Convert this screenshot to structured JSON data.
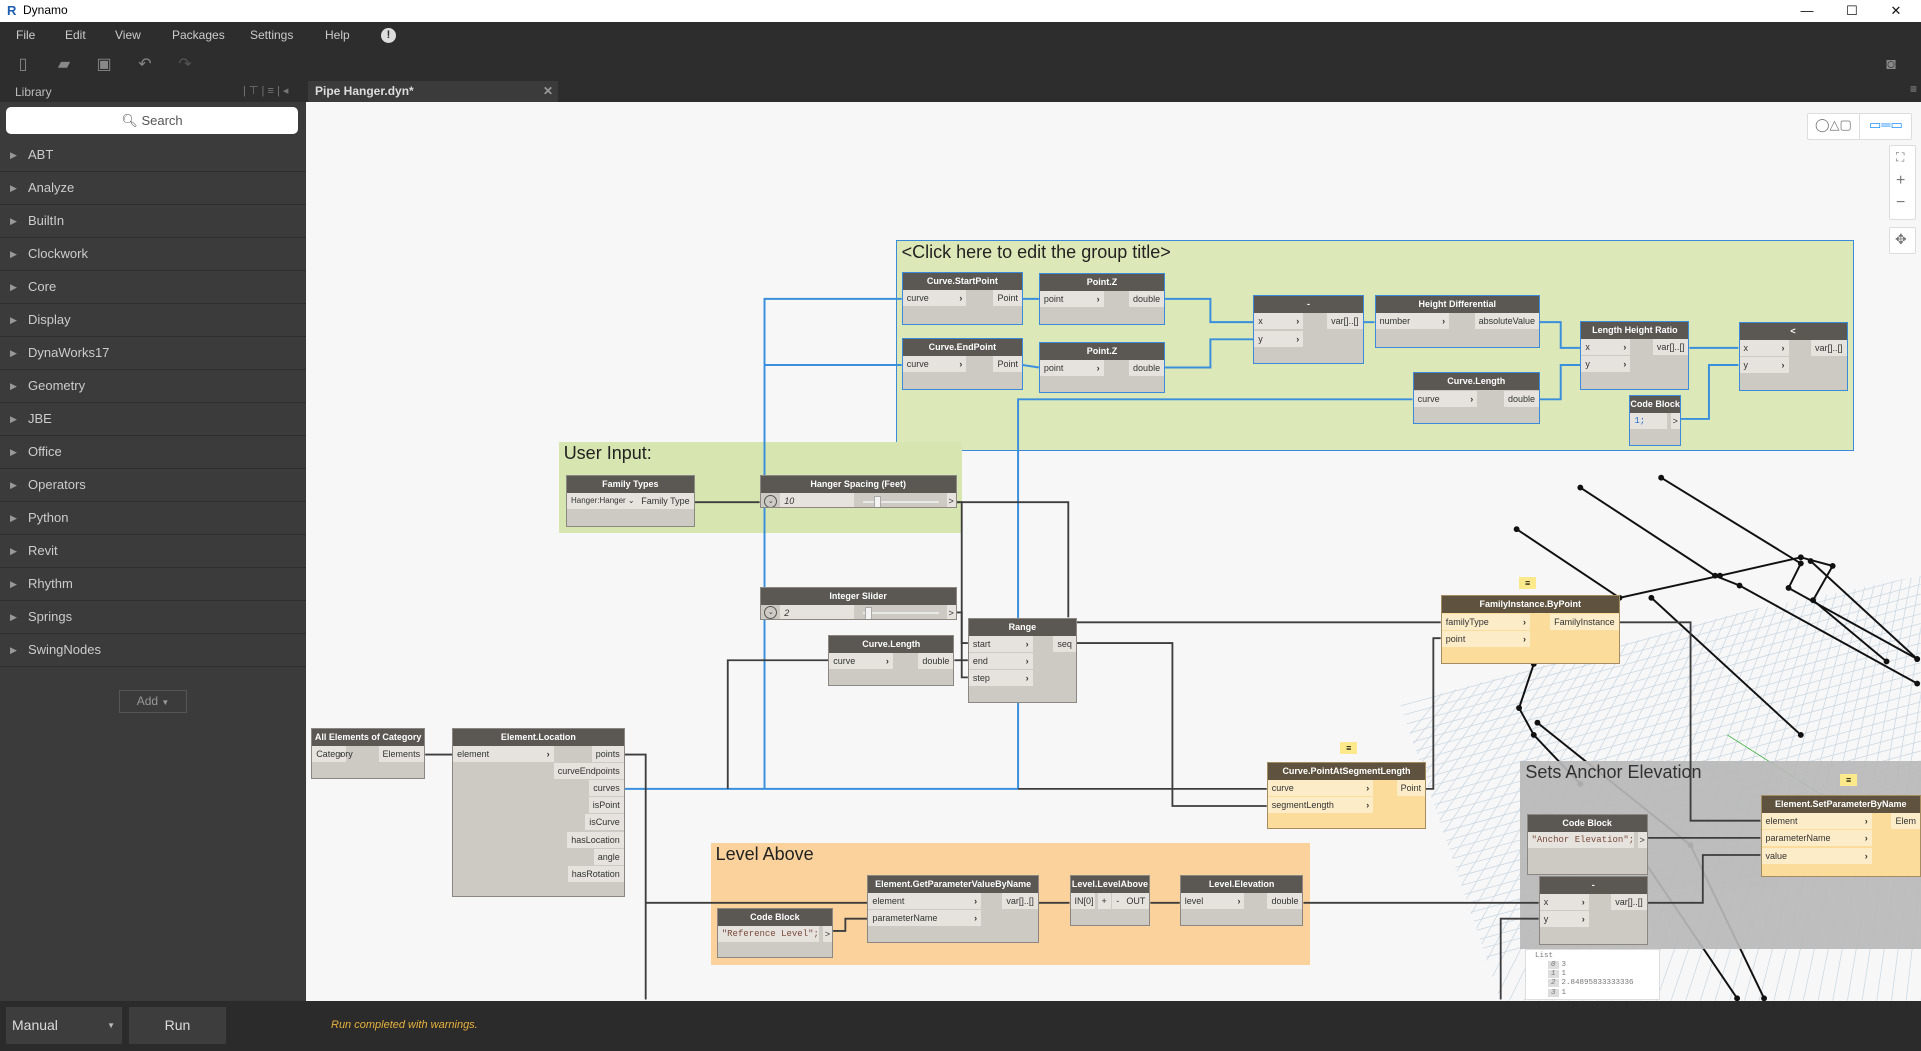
{
  "window": {
    "title": "Dynamo",
    "minimize": "—",
    "maximize": "☐",
    "close": "✕"
  },
  "menu": [
    "File",
    "Edit",
    "View",
    "Packages",
    "Settings",
    "Help"
  ],
  "library": {
    "header": "Library",
    "search_placeholder": "Search",
    "items": [
      "ABT",
      "Analyze",
      "BuiltIn",
      "Clockwork",
      "Core",
      "Display",
      "DynaWorks17",
      "Geometry",
      "JBE",
      "Office",
      "Operators",
      "Python",
      "Revit",
      "Rhythm",
      "Springs",
      "SwingNodes"
    ],
    "add_label": "Add"
  },
  "tab": {
    "label": "Pipe Hanger.dyn*"
  },
  "groups": [
    {
      "title": "<Click here to edit the group title>",
      "color": "#dce8b8"
    },
    {
      "title": "User Input:",
      "color": "#d7e6b0"
    },
    {
      "title": "Level Above",
      "color": "#fbd29c"
    },
    {
      "title": "Sets Anchor Elevation",
      "color": "#b9b9b9"
    }
  ],
  "nodes": [
    {
      "title": "Curve.StartPoint",
      "inputs": [
        "curve"
      ],
      "outputs": [
        "Point"
      ]
    },
    {
      "title": "Point.Z",
      "inputs": [
        "point"
      ],
      "outputs": [
        "double"
      ]
    },
    {
      "title": "Curve.EndPoint",
      "inputs": [
        "curve"
      ],
      "outputs": [
        "Point"
      ]
    },
    {
      "title": "Point.Z",
      "inputs": [
        "point"
      ],
      "outputs": [
        "double"
      ]
    },
    {
      "title": "-",
      "inputs": [
        "x",
        "y"
      ],
      "outputs": [
        "var[]..[]"
      ]
    },
    {
      "title": "Height Differential",
      "inputs": [
        "number"
      ],
      "outputs": [
        "absoluteValue"
      ]
    },
    {
      "title": "Length Height Ratio",
      "inputs": [
        "x",
        "y"
      ],
      "outputs": [
        "var[]..[]"
      ]
    },
    {
      "title": "<",
      "inputs": [
        "x",
        "y"
      ],
      "outputs": [
        "var[]..[]"
      ]
    },
    {
      "title": "Curve.Length",
      "inputs": [
        "curve"
      ],
      "outputs": [
        "double"
      ]
    },
    {
      "title": "Code Block",
      "code": "1;",
      "outputs": [
        ">"
      ]
    },
    {
      "title": "Family Types",
      "dropdown": "Hanger:Hanger",
      "outputs": [
        "Family Type"
      ]
    },
    {
      "title": "Hanger Spacing (Feet)",
      "slider": "10",
      "slider_fraction": 0.15,
      "outputs": [
        ">"
      ]
    },
    {
      "title": "Integer Slider",
      "slider": "2",
      "slider_fraction": 0.02,
      "outputs": [
        ">"
      ]
    },
    {
      "title": "Curve.Length",
      "inputs": [
        "curve"
      ],
      "outputs": [
        "double"
      ]
    },
    {
      "title": "Range",
      "inputs": [
        "start",
        "end",
        "step"
      ],
      "outputs": [
        "seq"
      ]
    },
    {
      "title": "All Elements of Category",
      "inputs": [
        "Category"
      ],
      "outputs": [
        "Elements"
      ]
    },
    {
      "title": "Element.Location",
      "inputs": [
        "element"
      ],
      "outputs": [
        "points",
        "curveEndpoints",
        "curves",
        "isPoint",
        "isCurve",
        "hasLocation",
        "angle",
        "hasRotation"
      ]
    },
    {
      "title": "FamilyInstance.ByPoint",
      "inputs": [
        "familyType",
        "point"
      ],
      "outputs": [
        "FamilyInstance"
      ]
    },
    {
      "title": "Curve.PointAtSegmentLength",
      "inputs": [
        "curve",
        "segmentLength"
      ],
      "outputs": [
        "Point"
      ]
    },
    {
      "title": "Element.GetParameterValueByName",
      "inputs": [
        "element",
        "parameterName"
      ],
      "outputs": [
        "var[]..[]"
      ]
    },
    {
      "title": "Code Block",
      "code": "\"Reference Level\";",
      "outputs": [
        ">"
      ]
    },
    {
      "title": "Level.LevelAbove",
      "inputs": [
        "IN[0]"
      ],
      "outputs": [
        "OUT"
      ],
      "plus": "+",
      "minus": "-"
    },
    {
      "title": "Level.Elevation",
      "inputs": [
        "level"
      ],
      "outputs": [
        "double"
      ]
    },
    {
      "title": "Code Block",
      "code": "\"Anchor Elevation\";",
      "outputs": [
        ">"
      ]
    },
    {
      "title": "-",
      "inputs": [
        "x",
        "y"
      ],
      "outputs": [
        "var[]..[]"
      ]
    },
    {
      "title": "Element.SetParameterByName",
      "inputs": [
        "element",
        "parameterName",
        "value"
      ],
      "outputs": [
        "Elem"
      ]
    }
  ],
  "watch": {
    "header": "List",
    "items": [
      {
        "i": "0",
        "v": "3"
      },
      {
        "i": "1",
        "v": "1"
      },
      {
        "i": "2",
        "v": "2.84895833333336"
      },
      {
        "i": "3",
        "v": "1"
      }
    ]
  },
  "bottom": {
    "run_mode": "Manual",
    "run_label": "Run",
    "status": "Run completed with warnings."
  }
}
